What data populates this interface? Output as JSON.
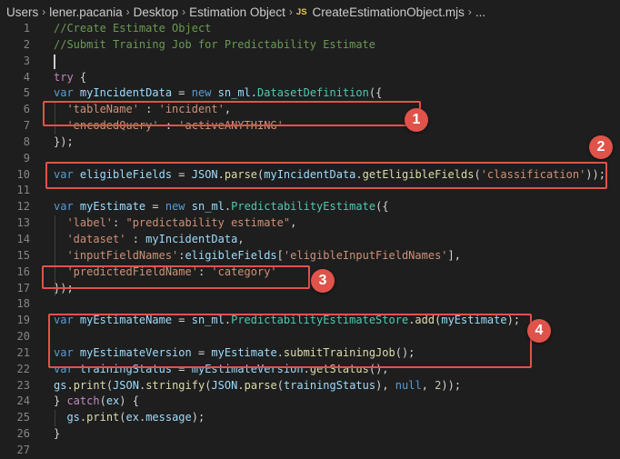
{
  "breadcrumb": {
    "items": [
      "Users",
      "lener.pacania",
      "Desktop",
      "Estimation Object"
    ],
    "file_icon": "JS",
    "file": "CreateEstimationObject.mjs",
    "more": "..."
  },
  "lines": [
    {
      "n": "1",
      "tokens": [
        {
          "t": "//Create Estimate Object",
          "c": "cm"
        }
      ]
    },
    {
      "n": "2",
      "tokens": [
        {
          "t": "//Submit Training Job for Predictability Estimate",
          "c": "cm"
        }
      ]
    },
    {
      "n": "3",
      "tokens": []
    },
    {
      "n": "4",
      "tokens": [
        {
          "t": "try",
          "c": "ctrl"
        },
        {
          "t": " {",
          "c": "pl"
        }
      ]
    },
    {
      "n": "5",
      "tokens": [
        {
          "t": "var",
          "c": "kw"
        },
        {
          "t": " myIncidentData",
          "c": "vr"
        },
        {
          "t": " = ",
          "c": "pl"
        },
        {
          "t": "new",
          "c": "kw"
        },
        {
          "t": " sn_ml",
          "c": "vr"
        },
        {
          "t": ".",
          "c": "pl"
        },
        {
          "t": "DatasetDefinition",
          "c": "cls"
        },
        {
          "t": "({",
          "c": "pl"
        }
      ]
    },
    {
      "n": "6",
      "tokens": [
        {
          "t": "  'tableName'",
          "c": "str"
        },
        {
          "t": " : ",
          "c": "pl"
        },
        {
          "t": "'incident'",
          "c": "str"
        },
        {
          "t": ",",
          "c": "pl"
        }
      ]
    },
    {
      "n": "7",
      "tokens": [
        {
          "t": "  'encodedQuery'",
          "c": "str"
        },
        {
          "t": " : ",
          "c": "pl"
        },
        {
          "t": "'activeANYTHING'",
          "c": "str"
        }
      ]
    },
    {
      "n": "8",
      "tokens": [
        {
          "t": "});",
          "c": "pl"
        }
      ]
    },
    {
      "n": "9",
      "tokens": []
    },
    {
      "n": "10",
      "tokens": [
        {
          "t": "var",
          "c": "kw"
        },
        {
          "t": " eligibleFields",
          "c": "vr"
        },
        {
          "t": " = ",
          "c": "pl"
        },
        {
          "t": "JSON",
          "c": "vr"
        },
        {
          "t": ".",
          "c": "pl"
        },
        {
          "t": "parse",
          "c": "fn"
        },
        {
          "t": "(",
          "c": "pl"
        },
        {
          "t": "myIncidentData",
          "c": "vr"
        },
        {
          "t": ".",
          "c": "pl"
        },
        {
          "t": "getEligibleFields",
          "c": "fn"
        },
        {
          "t": "(",
          "c": "pl"
        },
        {
          "t": "'classification'",
          "c": "str"
        },
        {
          "t": "));",
          "c": "pl"
        }
      ]
    },
    {
      "n": "11",
      "tokens": []
    },
    {
      "n": "12",
      "tokens": [
        {
          "t": "var",
          "c": "kw"
        },
        {
          "t": " myEstimate",
          "c": "vr"
        },
        {
          "t": " = ",
          "c": "pl"
        },
        {
          "t": "new",
          "c": "kw"
        },
        {
          "t": " sn_ml",
          "c": "vr"
        },
        {
          "t": ".",
          "c": "pl"
        },
        {
          "t": "PredictabilityEstimate",
          "c": "cls"
        },
        {
          "t": "({",
          "c": "pl"
        }
      ]
    },
    {
      "n": "13",
      "tokens": [
        {
          "t": "  'label'",
          "c": "str"
        },
        {
          "t": ": ",
          "c": "pl"
        },
        {
          "t": "\"predictability estimate\"",
          "c": "str"
        },
        {
          "t": ",",
          "c": "pl"
        }
      ]
    },
    {
      "n": "14",
      "tokens": [
        {
          "t": "  'dataset'",
          "c": "str"
        },
        {
          "t": " : ",
          "c": "pl"
        },
        {
          "t": "myIncidentData",
          "c": "vr"
        },
        {
          "t": ",",
          "c": "pl"
        }
      ]
    },
    {
      "n": "15",
      "tokens": [
        {
          "t": "  'inputFieldNames'",
          "c": "str"
        },
        {
          "t": ":",
          "c": "pl"
        },
        {
          "t": "eligibleFields",
          "c": "vr"
        },
        {
          "t": "[",
          "c": "pl"
        },
        {
          "t": "'eligibleInputFieldNames'",
          "c": "str"
        },
        {
          "t": "],",
          "c": "pl"
        }
      ]
    },
    {
      "n": "16",
      "tokens": [
        {
          "t": "  'predictedFieldName'",
          "c": "str"
        },
        {
          "t": ": ",
          "c": "pl"
        },
        {
          "t": "'category'",
          "c": "str"
        }
      ]
    },
    {
      "n": "17",
      "tokens": [
        {
          "t": "});",
          "c": "pl"
        }
      ]
    },
    {
      "n": "18",
      "tokens": []
    },
    {
      "n": "19",
      "tokens": [
        {
          "t": "var",
          "c": "kw"
        },
        {
          "t": " myEstimateName",
          "c": "vr"
        },
        {
          "t": " = ",
          "c": "pl"
        },
        {
          "t": "sn_ml",
          "c": "vr"
        },
        {
          "t": ".",
          "c": "pl"
        },
        {
          "t": "PredictabilityEstimateStore",
          "c": "cls"
        },
        {
          "t": ".",
          "c": "pl"
        },
        {
          "t": "add",
          "c": "fn"
        },
        {
          "t": "(",
          "c": "pl"
        },
        {
          "t": "myEstimate",
          "c": "vr"
        },
        {
          "t": ");",
          "c": "pl"
        }
      ]
    },
    {
      "n": "20",
      "tokens": []
    },
    {
      "n": "21",
      "tokens": [
        {
          "t": "var",
          "c": "kw"
        },
        {
          "t": " myEstimateVersion",
          "c": "vr"
        },
        {
          "t": " = ",
          "c": "pl"
        },
        {
          "t": "myEstimate",
          "c": "vr"
        },
        {
          "t": ".",
          "c": "pl"
        },
        {
          "t": "submitTrainingJob",
          "c": "fn"
        },
        {
          "t": "();",
          "c": "pl"
        }
      ]
    },
    {
      "n": "22",
      "tokens": [
        {
          "t": "var",
          "c": "kw"
        },
        {
          "t": " trainingStatus",
          "c": "vr"
        },
        {
          "t": " = ",
          "c": "pl"
        },
        {
          "t": "myEstimateVersion",
          "c": "vr"
        },
        {
          "t": ".",
          "c": "pl"
        },
        {
          "t": "getStatus",
          "c": "fn"
        },
        {
          "t": "();",
          "c": "pl"
        }
      ]
    },
    {
      "n": "23",
      "tokens": [
        {
          "t": "gs",
          "c": "vr"
        },
        {
          "t": ".",
          "c": "pl"
        },
        {
          "t": "print",
          "c": "fn"
        },
        {
          "t": "(",
          "c": "pl"
        },
        {
          "t": "JSON",
          "c": "vr"
        },
        {
          "t": ".",
          "c": "pl"
        },
        {
          "t": "stringify",
          "c": "fn"
        },
        {
          "t": "(",
          "c": "pl"
        },
        {
          "t": "JSON",
          "c": "vr"
        },
        {
          "t": ".",
          "c": "pl"
        },
        {
          "t": "parse",
          "c": "fn"
        },
        {
          "t": "(",
          "c": "pl"
        },
        {
          "t": "trainingStatus",
          "c": "vr"
        },
        {
          "t": "), ",
          "c": "pl"
        },
        {
          "t": "null",
          "c": "kw"
        },
        {
          "t": ", ",
          "c": "pl"
        },
        {
          "t": "2",
          "c": "num"
        },
        {
          "t": "));",
          "c": "pl"
        }
      ]
    },
    {
      "n": "24",
      "tokens": [
        {
          "t": "} ",
          "c": "pl"
        },
        {
          "t": "catch",
          "c": "ctrl"
        },
        {
          "t": "(",
          "c": "pl"
        },
        {
          "t": "ex",
          "c": "vr"
        },
        {
          "t": ") {",
          "c": "pl"
        }
      ]
    },
    {
      "n": "25",
      "tokens": [
        {
          "t": "  gs",
          "c": "vr"
        },
        {
          "t": ".",
          "c": "pl"
        },
        {
          "t": "print",
          "c": "fn"
        },
        {
          "t": "(",
          "c": "pl"
        },
        {
          "t": "ex",
          "c": "vr"
        },
        {
          "t": ".",
          "c": "pl"
        },
        {
          "t": "message",
          "c": "vr"
        },
        {
          "t": ");",
          "c": "pl"
        }
      ]
    },
    {
      "n": "26",
      "tokens": [
        {
          "t": "}",
          "c": "pl"
        }
      ]
    },
    {
      "n": "27",
      "tokens": []
    }
  ],
  "annotations": [
    {
      "label": "1"
    },
    {
      "label": "2"
    },
    {
      "label": "3"
    },
    {
      "label": "4"
    }
  ],
  "colors": {
    "accent": "#e0534a",
    "background": "#1e1e1e"
  }
}
